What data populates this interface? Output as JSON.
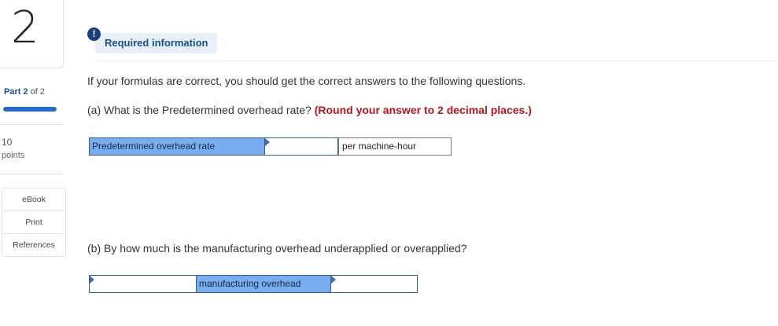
{
  "sidebar": {
    "question_number": "2",
    "part_prefix": "Part",
    "part_current": "2",
    "part_of": "of 2",
    "progress_fraction": 1.0,
    "points_value": "10",
    "points_label": "points",
    "buttons": [
      "eBook",
      "Print",
      "References"
    ]
  },
  "header": {
    "info_icon": "!",
    "required_label": "Required information"
  },
  "main": {
    "intro": "If your formulas are correct, you should get the correct answers to the following questions.",
    "question_a": "(a) What is the Predetermined overhead rate?",
    "question_a_note": "(Round your answer to 2 decimal places.)",
    "row_a": {
      "label": "Predetermined overhead rate",
      "value": "",
      "unit": "per machine-hour"
    },
    "question_b": "(b) By how much is the manufacturing overhead underapplied or overapplied?",
    "row_b": {
      "select_value": "",
      "label": "manufacturing overhead",
      "value": ""
    }
  },
  "colors": {
    "accent": "#1b4f8a",
    "label_cell": "#78aef0",
    "emphasis_red": "#b3161b"
  }
}
